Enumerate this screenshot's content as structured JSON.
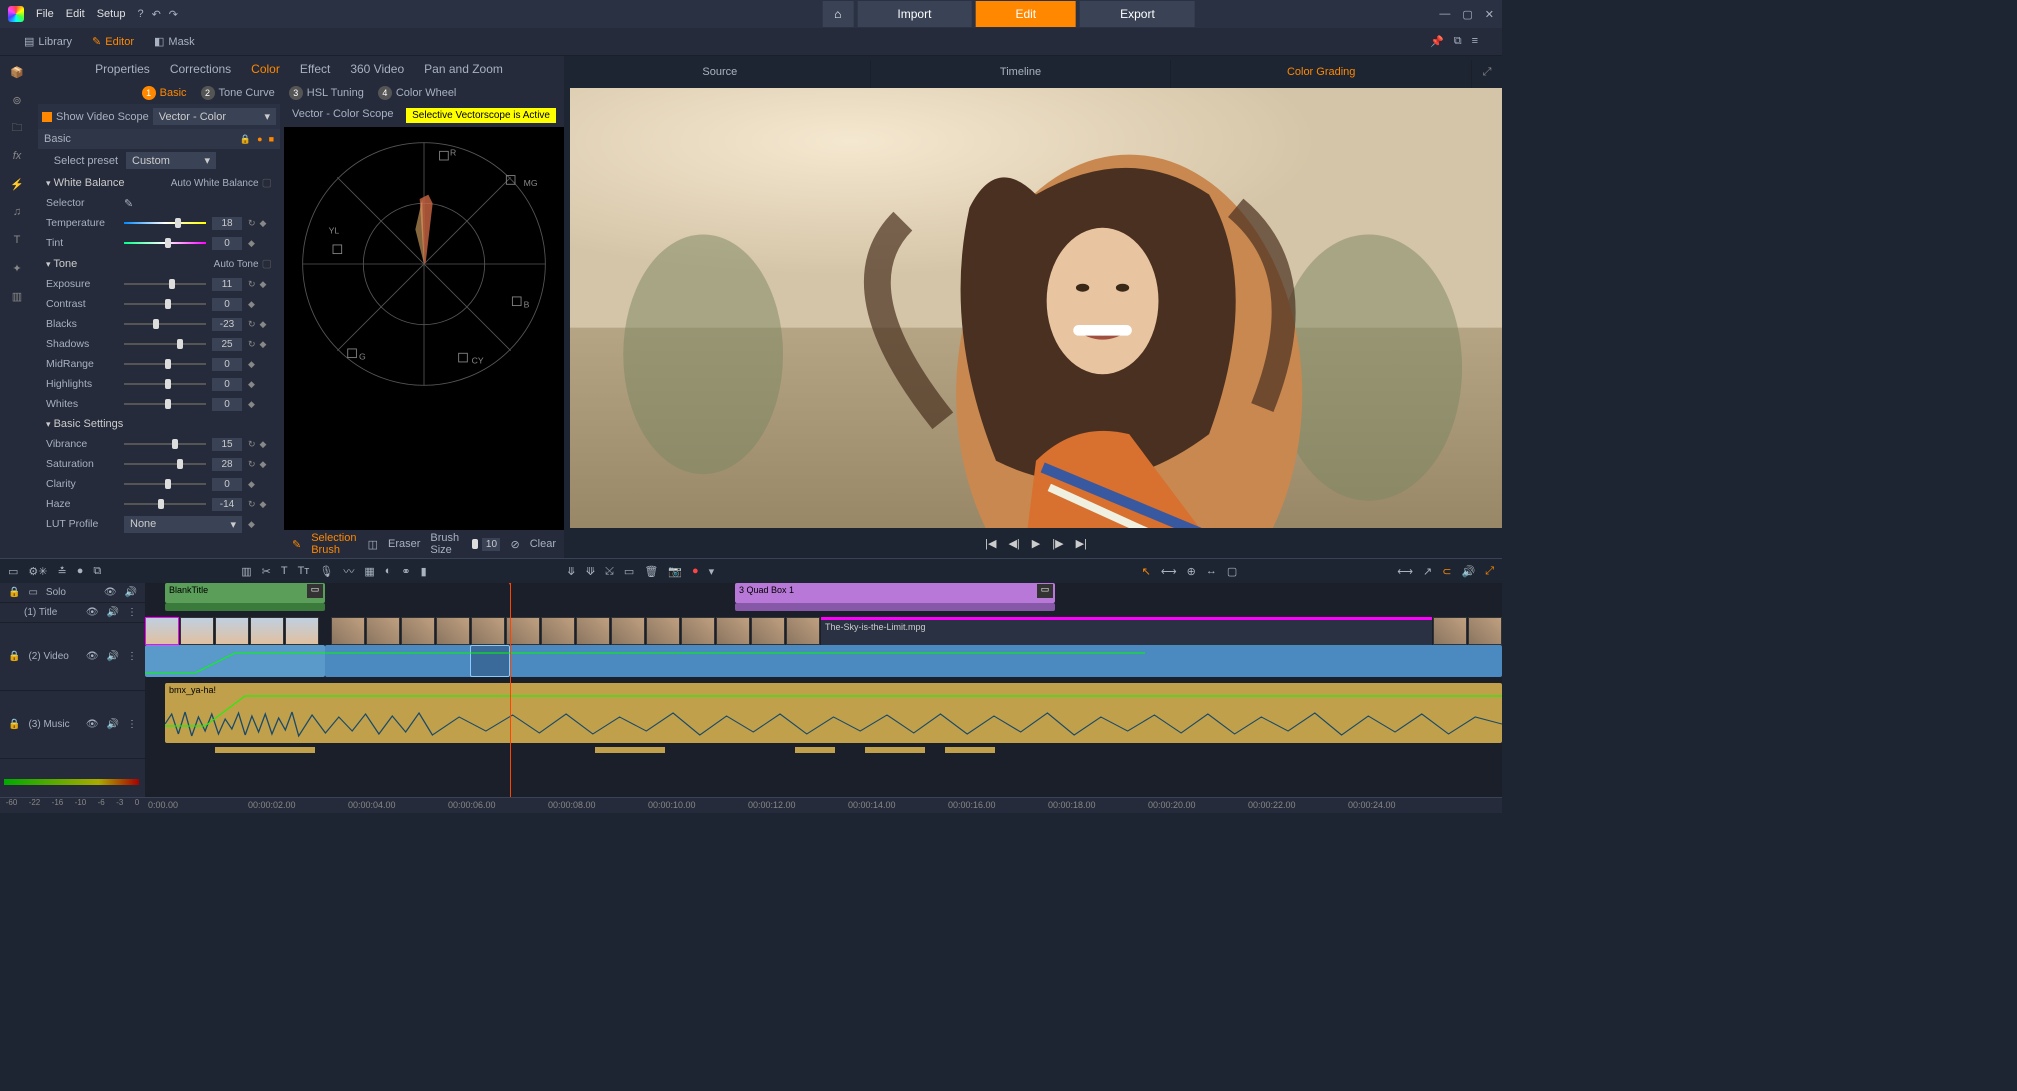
{
  "menubar": {
    "items": [
      "File",
      "Edit",
      "Setup"
    ],
    "modes": {
      "import": "Import",
      "edit": "Edit",
      "export": "Export"
    }
  },
  "toolbar": {
    "tabs": {
      "library": "Library",
      "editor": "Editor",
      "mask": "Mask"
    }
  },
  "subtabs": [
    "Properties",
    "Corrections",
    "Color",
    "Effect",
    "360 Video",
    "Pan and Zoom"
  ],
  "subsubtabs": [
    "Basic",
    "Tone Curve",
    "HSL Tuning",
    "Color Wheel"
  ],
  "scope": {
    "show_label": "Show Video Scope",
    "type": "Vector - Color",
    "title": "Vector - Color Scope",
    "badge": "Selective Vectorscope is Active"
  },
  "basic_header": "Basic",
  "preset": {
    "label": "Select preset",
    "value": "Custom"
  },
  "groups": {
    "white_balance": {
      "title": "White Balance",
      "auto": "Auto White Balance",
      "selector": "Selector"
    },
    "tone": {
      "title": "Tone",
      "auto": "Auto Tone"
    },
    "basic_settings": {
      "title": "Basic Settings"
    }
  },
  "sliders": {
    "temperature": {
      "label": "Temperature",
      "value": "18",
      "pos": 62
    },
    "tint": {
      "label": "Tint",
      "value": "0",
      "pos": 50
    },
    "exposure": {
      "label": "Exposure",
      "value": "11",
      "pos": 55
    },
    "contrast": {
      "label": "Contrast",
      "value": "0",
      "pos": 50
    },
    "blacks": {
      "label": "Blacks",
      "value": "-23",
      "pos": 35
    },
    "shadows": {
      "label": "Shadows",
      "value": "25",
      "pos": 65
    },
    "midrange": {
      "label": "MidRange",
      "value": "0",
      "pos": 50
    },
    "highlights": {
      "label": "Highlights",
      "value": "0",
      "pos": 50
    },
    "whites": {
      "label": "Whites",
      "value": "0",
      "pos": 50
    },
    "vibrance": {
      "label": "Vibrance",
      "value": "15",
      "pos": 58
    },
    "saturation": {
      "label": "Saturation",
      "value": "28",
      "pos": 65
    },
    "clarity": {
      "label": "Clarity",
      "value": "0",
      "pos": 50
    },
    "haze": {
      "label": "Haze",
      "value": "-14",
      "pos": 42
    }
  },
  "lut": {
    "label": "LUT Profile",
    "value": "None"
  },
  "scope_footer": {
    "brush": "Selection Brush",
    "eraser": "Eraser",
    "size_label": "Brush Size",
    "size": "10",
    "clear": "Clear"
  },
  "viewer_tabs": [
    "Source",
    "Timeline",
    "Color Grading"
  ],
  "tracks": {
    "solo": "Solo",
    "title": "(1) Title",
    "video": "(2) Video",
    "music": "(3) Music"
  },
  "clips": {
    "title1": "BlankTitle",
    "title2": "3 Quad Box 1",
    "video_name": "The-Sky-is-the-Limit.mpg",
    "music_name": "bmx_ya-ha!"
  },
  "ruler": [
    "0:00.00",
    "00:00:02.00",
    "00:00:04.00",
    "00:00:06.00",
    "00:00:08.00",
    "00:00:10.00",
    "00:00:12.00",
    "00:00:14.00",
    "00:00:16.00",
    "00:00:18.00",
    "00:00:20.00",
    "00:00:22.00",
    "00:00:24.00"
  ],
  "meter": [
    "-60",
    "-22",
    "-16",
    "-10",
    "-6",
    "-3",
    "0"
  ]
}
